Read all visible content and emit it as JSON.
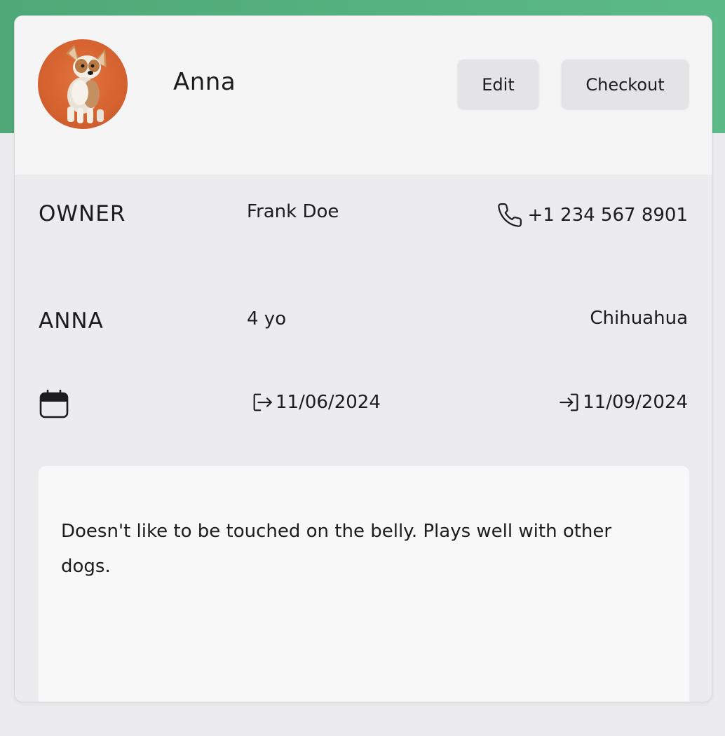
{
  "header": {
    "pet_name": "Anna",
    "edit_label": "Edit",
    "checkout_label": "Checkout"
  },
  "owner": {
    "label": "OWNER",
    "name": "Frank Doe",
    "phone": "+1 234 567 8901"
  },
  "pet": {
    "label": "ANNA",
    "age": "4 yo",
    "breed": "Chihuahua"
  },
  "stay": {
    "check_in": "11/06/2024",
    "check_out": "11/09/2024"
  },
  "notes": {
    "text": "Doesn't like to be touched on the belly. Plays well with other dogs."
  },
  "colors": {
    "header_band": "#5cba88",
    "card_header_bg": "#f5f5f5",
    "card_body_bg": "#ececee",
    "button_bg": "#e4e4e6",
    "avatar_bg": "#d5622f"
  },
  "icons": {
    "phone": "phone-icon",
    "calendar": "calendar-icon",
    "check_in": "login-arrow-icon",
    "check_out": "enter-arrow-icon"
  }
}
